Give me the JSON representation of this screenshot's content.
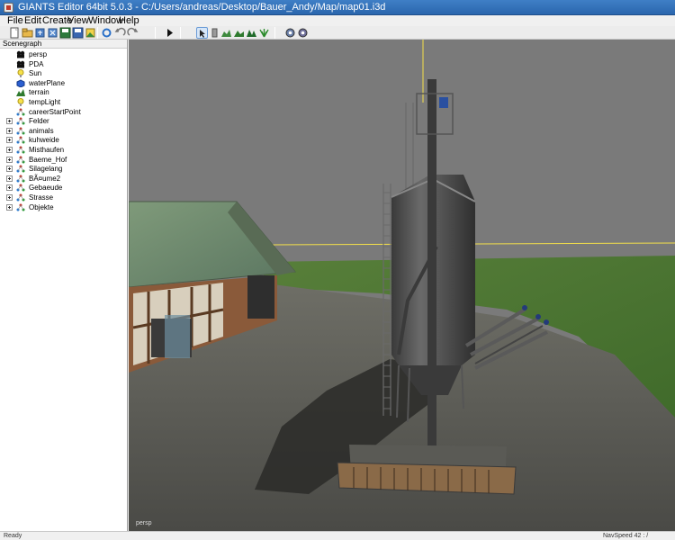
{
  "window": {
    "title": "GIANTS Editor 64bit 5.0.3 - C:/Users/andreas/Desktop/Bauer_Andy/Map/map01.i3d"
  },
  "menu": {
    "items": [
      "File",
      "Edit",
      "Create",
      "View",
      "Window",
      "Help"
    ]
  },
  "toolbar": {
    "buttons": [
      "new-icon",
      "open-icon",
      "import-icon",
      "export-icon",
      "save-icon",
      "save-all-icon",
      "undo-icon",
      "redo-icon",
      "play-icon",
      "select-icon",
      "move-icon",
      "terrain-sculpt-icon",
      "terrain-paint-icon",
      "foliage-paint-icon",
      "foliage-icon",
      "settings-icon",
      "settings-alt-icon"
    ]
  },
  "scenegraph": {
    "title": "Scenegraph",
    "nodes": [
      {
        "label": "persp",
        "icon": "camera-icon",
        "expandable": false
      },
      {
        "label": "PDA",
        "icon": "camera-icon",
        "expandable": false
      },
      {
        "label": "Sun",
        "icon": "light-icon",
        "expandable": false
      },
      {
        "label": "waterPlane",
        "icon": "shape-icon",
        "expandable": false
      },
      {
        "label": "terrain",
        "icon": "terrain-icon",
        "expandable": false
      },
      {
        "label": "tempLight",
        "icon": "light-icon",
        "expandable": false
      },
      {
        "label": "careerStartPoint",
        "icon": "transform-group-icon",
        "expandable": false
      },
      {
        "label": "Felder",
        "icon": "transform-group-icon",
        "expandable": true
      },
      {
        "label": "animals",
        "icon": "transform-group-icon",
        "expandable": true
      },
      {
        "label": "kuhweide",
        "icon": "transform-group-icon",
        "expandable": true
      },
      {
        "label": "Misthaufen",
        "icon": "transform-group-icon",
        "expandable": true
      },
      {
        "label": "Baeme_Hof",
        "icon": "transform-group-icon",
        "expandable": true
      },
      {
        "label": "Silagelang",
        "icon": "transform-group-icon",
        "expandable": true
      },
      {
        "label": "BÃ¤ume2",
        "icon": "transform-group-icon",
        "expandable": true
      },
      {
        "label": "Gebaeude",
        "icon": "transform-group-icon",
        "expandable": true
      },
      {
        "label": "Strasse",
        "icon": "transform-group-icon",
        "expandable": true
      },
      {
        "label": "Objekte",
        "icon": "transform-group-icon",
        "expandable": true
      }
    ]
  },
  "viewport": {
    "camera_label": "persp"
  },
  "status": {
    "left": "Ready",
    "right": "NavSpeed 42 : /"
  },
  "colors": {
    "title_bar": "#2f6fb8",
    "sky": "#7a7a7a",
    "grass": "#4d7a34",
    "roof": "#6f8a6a",
    "selection_yellow": "#f4e04a"
  }
}
